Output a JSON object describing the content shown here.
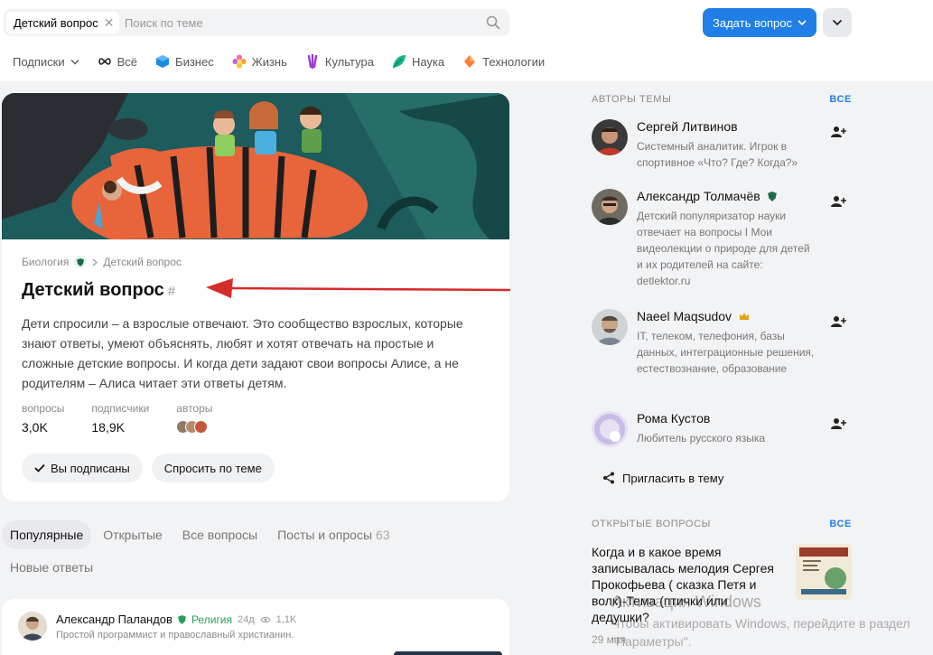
{
  "header": {
    "search_chip": "Детский вопрос",
    "search_placeholder": "Поиск по теме",
    "ask_button": "Задать вопрос"
  },
  "topics": [
    {
      "label": "Подписки",
      "icon": "chevron-down-icon"
    },
    {
      "label": "Всё",
      "icon": "infinity-icon"
    },
    {
      "label": "Бизнес",
      "icon": "cube-icon"
    },
    {
      "label": "Жизнь",
      "icon": "flower-icon"
    },
    {
      "label": "Культура",
      "icon": "culture-icon"
    },
    {
      "label": "Наука",
      "icon": "leaf-icon"
    },
    {
      "label": "Технологии",
      "icon": "diamond-icon"
    }
  ],
  "community": {
    "breadcrumb_parent": "Биология",
    "breadcrumb_current": "Детский вопрос",
    "title": "Детский вопрос",
    "hash": "#",
    "description": "Дети спросили – а взрослые отвечают. Это сообщество взрослых, которые знают ответы, умеют объяснять, любят и хотят отвечать на простые и сложные детские вопросы. И когда дети задают свои вопросы Алисе, а не родителям – Алиса читает эти ответы детям.",
    "stats": {
      "questions_label": "вопросы",
      "questions_value": "3,0K",
      "subscribers_label": "подписчики",
      "subscribers_value": "18,9K",
      "authors_label": "авторы"
    },
    "subscribed_button": "Вы подписаны",
    "ask_topic_button": "Спросить по теме"
  },
  "tabs": [
    {
      "label": "Популярные",
      "active": true
    },
    {
      "label": "Открытые",
      "active": false
    },
    {
      "label": "Все вопросы",
      "active": false
    },
    {
      "label": "Посты и опросы",
      "count": "63",
      "active": false
    },
    {
      "label": "Новые ответы",
      "active": false
    }
  ],
  "post": {
    "author": "Александр Паландов",
    "topic": "Религия",
    "age": "24д",
    "views": "1,1K",
    "bio": "Простой программист и православный христианин."
  },
  "authors_section": {
    "heading": "АВТОРЫ ТЕМЫ",
    "all_link": "ВСЕ",
    "items": [
      {
        "name": "Сергей Литвинов",
        "bio": "Системный аналитик. Игрок в спортивное «Что? Где? Когда?»"
      },
      {
        "name": "Александр Толмачёв",
        "bio": "Детский популяризатор науки отвечает на вопросы I Мои видеолекции о природе для детей и их родителей на сайте: detlektor.ru"
      },
      {
        "name": "Naeel Maqsudov",
        "bio": "IT, телеком, телефония, базы данных, интеграционные решения, естествознание, образование"
      },
      {
        "name": "Рома Кустов",
        "bio": "Любитель русского языка"
      }
    ],
    "invite_button": "Пригласить в тему"
  },
  "open_questions": {
    "heading": "ОТКРЫТЫЕ ВОПРОСЫ",
    "all_link": "ВСЕ",
    "question": "Когда и в какое время записывалась мелодия Сергея Прокофьева ( сказка Петя и волк)-Тема (птички или дедушки?",
    "date": "29 мая"
  },
  "watermark": {
    "line1": "Активация Windows",
    "line2": "Чтобы активировать Windows, перейдите в раздел",
    "line3": "\"Параметры\"."
  },
  "colors": {
    "accent": "#1f7fe7",
    "arrow": "#d62b2b",
    "religion": "#2a9d5c"
  }
}
